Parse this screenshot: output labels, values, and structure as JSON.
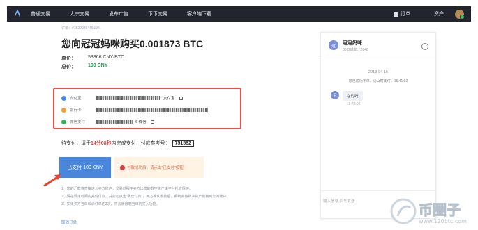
{
  "nav": {
    "items": [
      "普通交易",
      "大宗交易",
      "发布广告",
      "币币交易",
      "客户端下载"
    ],
    "orders_label": "订单",
    "assets_label": "资产"
  },
  "order": {
    "number": "订单：#15229864491594",
    "title": "您向冠冠妈咪购买0.001873 BTC",
    "unit_price_label": "单价：",
    "unit_price": "53366 CNY/BTC",
    "total_label": "总价：",
    "total": "100 CNY"
  },
  "payment_methods": [
    {
      "name": "支付宝",
      "extra": "支付宝",
      "color": "#3f8ae8"
    },
    {
      "name": "银行卡",
      "extra": "",
      "color": "#f39b2f"
    },
    {
      "name": "微信支付",
      "extra": "6  微信",
      "color": "#2fb45a"
    }
  ],
  "wait": {
    "prefix": "待支付，请于",
    "countdown": "14分08秒",
    "middle": "内完成支付，付款参考号：",
    "ref_code": "751582"
  },
  "paid_button": "已支付 100 CNY",
  "notice": "付款成功后，请点击\"已支付\"按钮",
  "tips": [
    "1、您的汇款将直接进入卖方账户，交易过程中卖方出售的数字资产由平台托管保护。",
    "2、请在规定时间内完成付款，并务必点击\"我已付款\"，卖方确认收款后，系统会将数字资产划转到您的账户。",
    "3、如果买方当日取消订单达3次，将会被限制当日的买入功能。"
  ],
  "cancel_label": "取消订单",
  "chat": {
    "avatar_text": "冠",
    "name": "冠冠妈咪",
    "sub": "30日成单：2848",
    "date": "2018-04-16",
    "system": "您已成功下单，请及时支付，15:41:02",
    "message": "在的吗",
    "message_time": "15:42:04",
    "input_placeholder": "输入信息,回车发送"
  },
  "watermark": {
    "text": "币圈子",
    "url": "www.120btc.com"
  }
}
